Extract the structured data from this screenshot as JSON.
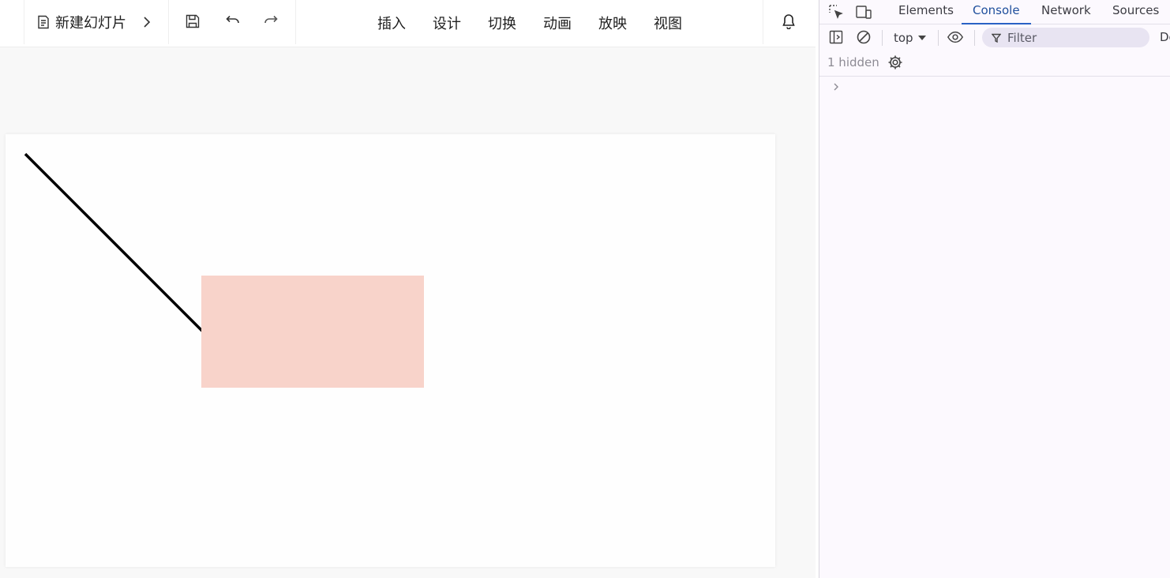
{
  "app": {
    "doc_title": "新建幻灯片",
    "menu": [
      "插入",
      "设计",
      "切换",
      "动画",
      "放映",
      "视图"
    ],
    "icons": {
      "doc": "document-icon",
      "chevron": "chevron-right-icon",
      "save": "save-icon",
      "undo": "undo-icon",
      "redo": "redo-icon",
      "bell": "bell-icon"
    },
    "slide": {
      "shapes": [
        {
          "type": "line",
          "stroke": "#000000"
        },
        {
          "type": "rect",
          "fill": "#f8d3ca"
        }
      ]
    }
  },
  "devtools": {
    "tabs": [
      "Elements",
      "Console",
      "Network",
      "Sources"
    ],
    "active_tab": "Console",
    "context": "top",
    "filter_placeholder": "Filter",
    "levels_label": "De",
    "hidden_count_text": "1 hidden",
    "accent_color": "#2a62c5"
  }
}
